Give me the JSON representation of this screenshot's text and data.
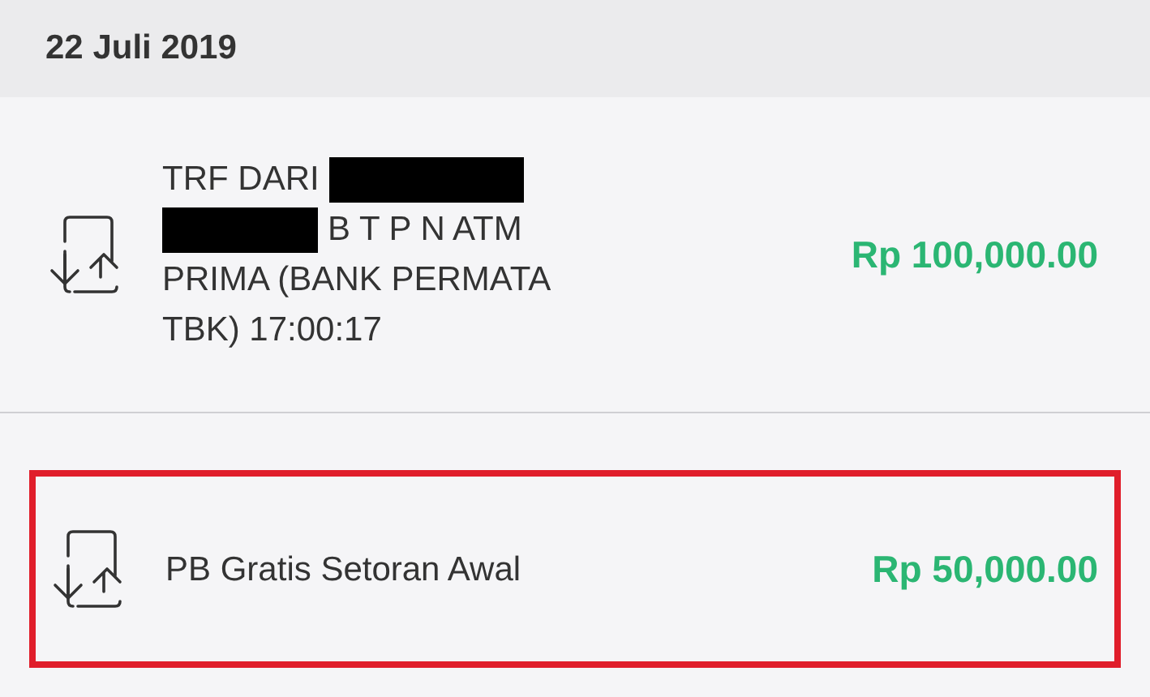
{
  "date_header": "22 Juli 2019",
  "transactions": [
    {
      "highlighted": false,
      "amount": "Rp 100,000.00",
      "lines": [
        [
          {
            "kind": "text",
            "text": "TRF DARI"
          },
          {
            "kind": "redacted"
          }
        ],
        [
          {
            "kind": "redacted"
          },
          {
            "kind": "text",
            "text": "B T P N ATM"
          }
        ],
        [
          {
            "kind": "text",
            "text": "PRIMA (BANK PERMATA"
          }
        ],
        [
          {
            "kind": "text",
            "text": "TBK) 17:00:17"
          }
        ]
      ]
    },
    {
      "highlighted": true,
      "amount": "Rp 50,000.00",
      "lines": [
        [
          {
            "kind": "text",
            "text": "PB Gratis Setoran Awal"
          }
        ]
      ]
    }
  ]
}
